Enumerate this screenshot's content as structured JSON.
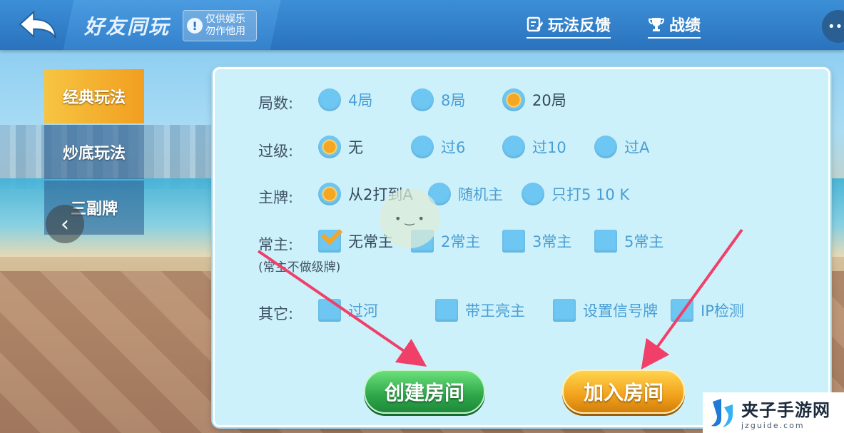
{
  "header": {
    "title": "好友同玩",
    "notice_icon": "!",
    "notice_line1": "仅供娱乐",
    "notice_line2": "勿作他用",
    "feedback_label": "玩法反馈",
    "record_label": "战绩",
    "more_label": "••"
  },
  "tabs": [
    {
      "label": "经典玩法",
      "active": true
    },
    {
      "label": "炒底玩法",
      "active": false
    },
    {
      "label": "三副牌",
      "active": false
    }
  ],
  "options": {
    "rounds": {
      "label": "局数:",
      "items": [
        {
          "label": "4局",
          "selected": false
        },
        {
          "label": "8局",
          "selected": false
        },
        {
          "label": "20局",
          "selected": true
        }
      ]
    },
    "pass_level": {
      "label": "过级:",
      "items": [
        {
          "label": "无",
          "selected": true
        },
        {
          "label": "过6",
          "selected": false
        },
        {
          "label": "过10",
          "selected": false
        },
        {
          "label": "过A",
          "selected": false
        }
      ]
    },
    "main_card": {
      "label": "主牌:",
      "items": [
        {
          "label": "从2打到A",
          "selected": true
        },
        {
          "label": "随机主",
          "selected": false
        },
        {
          "label": "只打5 10 K",
          "selected": false
        }
      ]
    },
    "constant_main": {
      "label": "常主:",
      "note": "(常主不做级牌)",
      "items": [
        {
          "label": "无常主",
          "selected": true
        },
        {
          "label": "2常主",
          "selected": false
        },
        {
          "label": "3常主",
          "selected": false
        },
        {
          "label": "5常主",
          "selected": false
        }
      ]
    },
    "others": {
      "label": "其它:",
      "items": [
        {
          "label": "过河",
          "selected": false
        },
        {
          "label": "带王亮主",
          "selected": false
        },
        {
          "label": "设置信号牌",
          "selected": false
        },
        {
          "label": "IP检测",
          "selected": false
        }
      ]
    }
  },
  "buttons": {
    "create_room": "创建房间",
    "join_room": "加入房间"
  },
  "watermark": {
    "site_cn": "夹子手游网",
    "site_en": "jzguide.com"
  },
  "colors": {
    "accent_orange": "#f5a623",
    "option_blue": "#6ec6f2",
    "create_green": "#2ea64a",
    "join_gold": "#f2a11b",
    "arrow_pink": "#f0406a"
  }
}
